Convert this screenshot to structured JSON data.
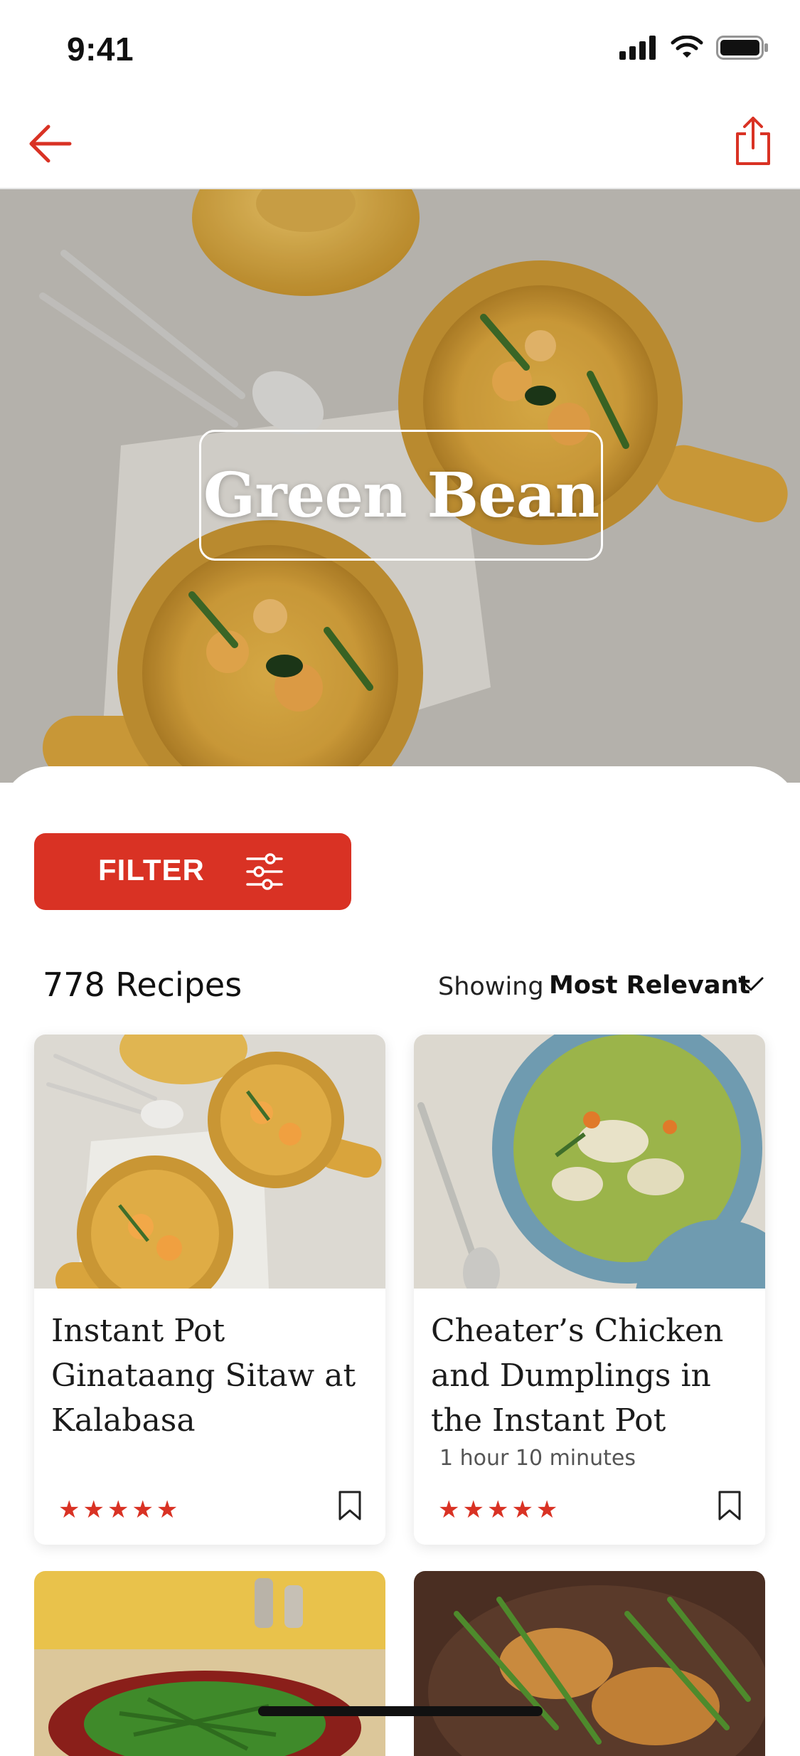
{
  "status_bar": {
    "time": "9:41"
  },
  "nav": {
    "back_icon": "arrow-left-icon",
    "share_icon": "share-icon"
  },
  "hero": {
    "title": "Green Bean"
  },
  "filter": {
    "label": "FILTER",
    "icon": "sliders-icon"
  },
  "results": {
    "count_label": "778 Recipes",
    "showing_label": "Showing",
    "sort_value": "Most Relevant"
  },
  "cards": [
    {
      "title": "Instant Pot Ginataang Sitaw at Kalabasa",
      "time": "",
      "stars": "★★★★★",
      "rating": 5
    },
    {
      "title": "Cheater’s Chicken and Dumplings in the Instant Pot",
      "time": "1 hour 10 minutes",
      "stars": "★★★★★",
      "rating": 5
    }
  ],
  "colors": {
    "accent": "#d93224",
    "text": "#111111",
    "divider": "#e5e5e5"
  }
}
